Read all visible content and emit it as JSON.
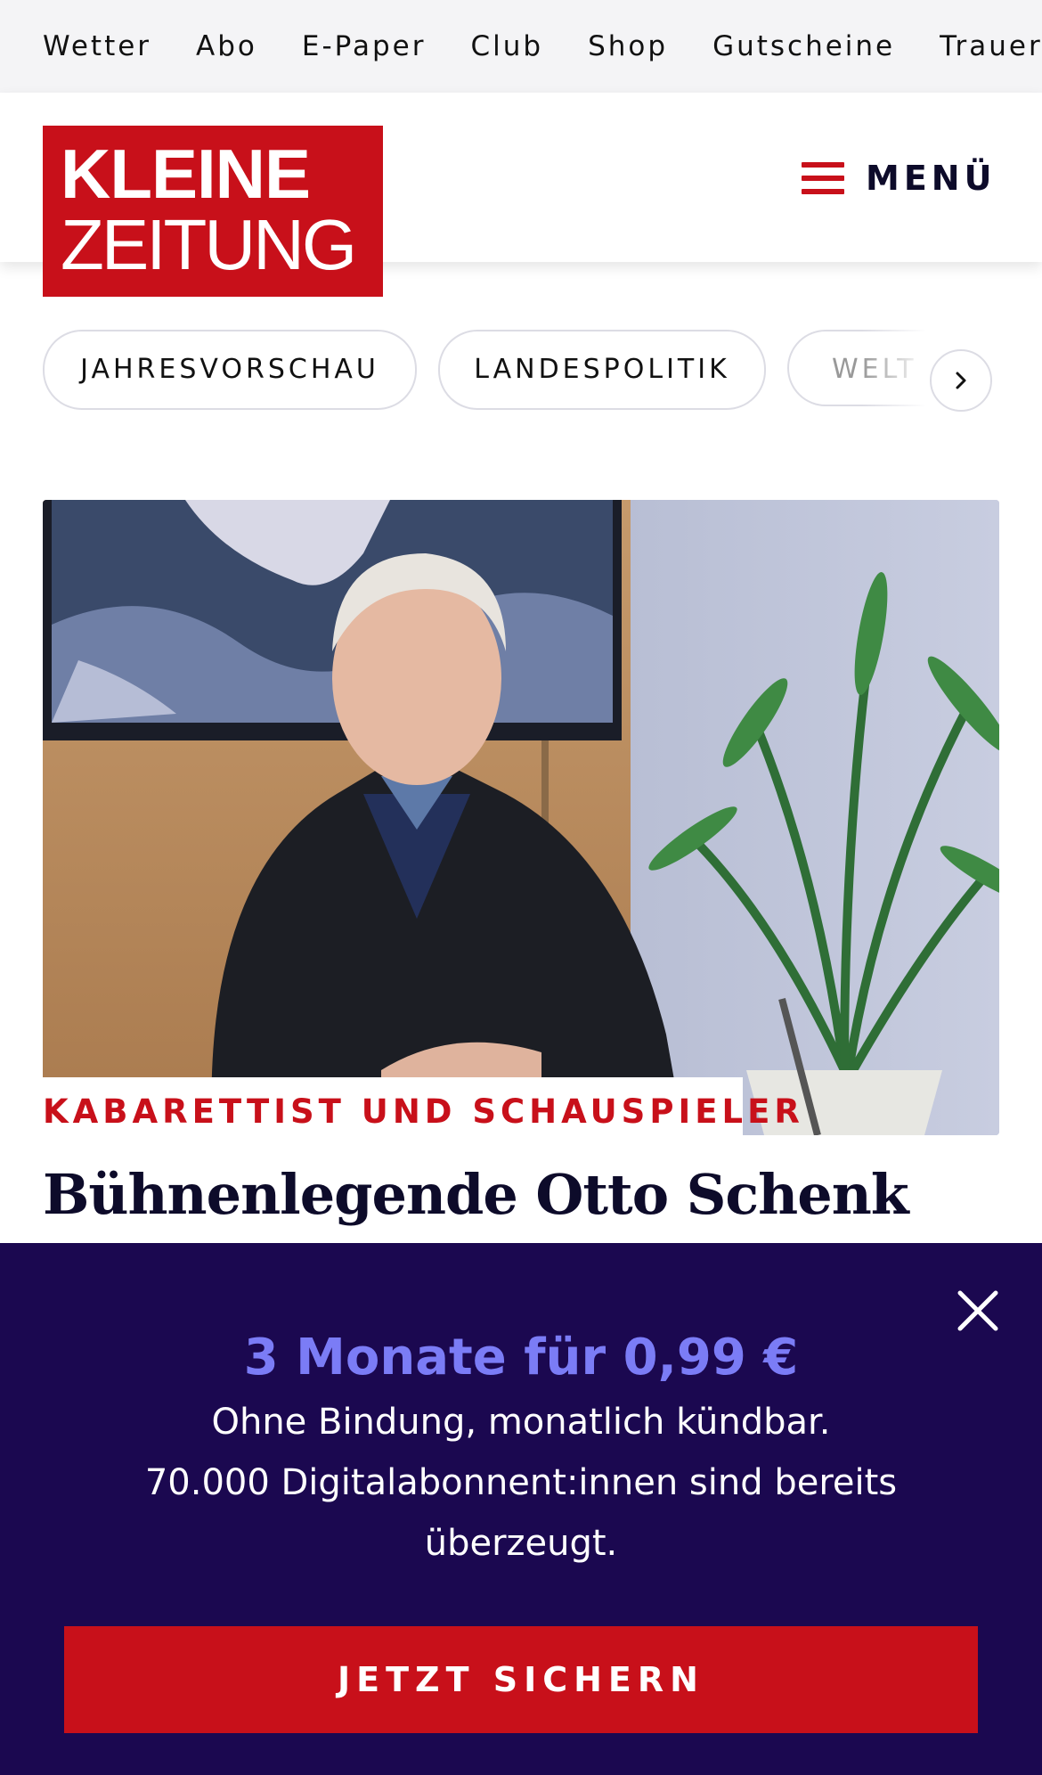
{
  "top_nav": {
    "items": [
      "Wetter",
      "Abo",
      "E-Paper",
      "Club",
      "Shop",
      "Gutscheine",
      "Trauerportal"
    ]
  },
  "header": {
    "logo_line1": "KLEINE",
    "logo_line2": "ZEITUNG",
    "menu_label": "MENÜ"
  },
  "topics": {
    "chips": [
      "JAHRESVORSCHAU",
      "LANDESPOLITIK",
      "WELT"
    ]
  },
  "article": {
    "kicker": "KABARETTIST UND SCHAUSPIELER",
    "headline": "Bühnenlegende Otto Schenk"
  },
  "promo": {
    "title": "3 Monate für 0,99 €",
    "line1": "Ohne Bindung, monatlich kündbar.",
    "line2": "70.000 Digitalabonnent:innen sind bereits",
    "line3": "überzeugt.",
    "cta": "JETZT SICHERN"
  },
  "colors": {
    "brand_red": "#c8101a",
    "overlay_bg": "#1b0850",
    "promo_accent": "#7b7cf6"
  }
}
